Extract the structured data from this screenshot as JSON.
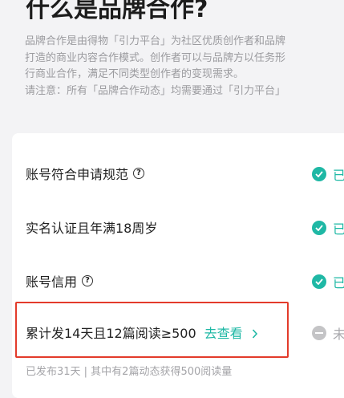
{
  "page_title": "什么是品牌合作?",
  "description": {
    "line1": "品牌合作是由得物「引力平台」为社区优质创作者和品牌",
    "line2": "打造的商业内容合作模式。创作者可以与品牌方以任务形",
    "line3": "行商业合作，满足不同类型创作者的变现需求。",
    "line4": "请注意：所有「品牌合作动态」均需要通过「引力平台」"
  },
  "requirements": [
    {
      "label": "账号符合申请规范",
      "status": "已"
    },
    {
      "label": "实名认证且年满18周岁",
      "status": "已"
    },
    {
      "label": "账号信用",
      "status": "已"
    },
    {
      "label": "累计发14天且12篇阅读≥500",
      "link": "去查看",
      "status": "未"
    }
  ],
  "progress_note": "已发布31天 | 其中有2篇动态获得500阅读量",
  "colors": {
    "accent": "#1fb8a5",
    "highlight_border": "#e33b2b",
    "pending": "#c4c4c6"
  },
  "icons": {
    "help": "question-circle-icon",
    "done": "check-circle-icon",
    "pending": "minus-circle-icon",
    "link_arrow": "chevron-right-icon"
  }
}
